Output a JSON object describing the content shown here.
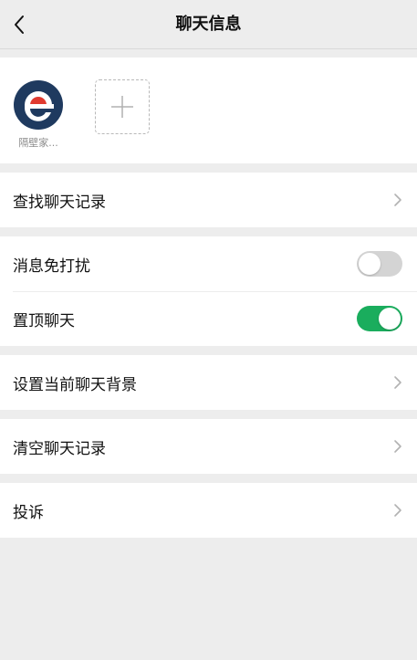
{
  "nav": {
    "title": "聊天信息"
  },
  "members": [
    {
      "name": "隔壁家..."
    }
  ],
  "items": {
    "search_history": "查找聊天记录",
    "mute": "消息免打扰",
    "mute_on": false,
    "sticky": "置顶聊天",
    "sticky_on": true,
    "background": "设置当前聊天背景",
    "clear_history": "清空聊天记录",
    "report": "投诉"
  },
  "colors": {
    "background": "#ededed",
    "switch_on": "#1aad5d",
    "switch_off": "#d4d4d4",
    "avatar_navy": "#1f3a5f",
    "avatar_red": "#e03a2f"
  },
  "icons": {
    "back": "back-arrow-icon",
    "add": "plus-icon",
    "chevron": "chevron-right-icon"
  }
}
